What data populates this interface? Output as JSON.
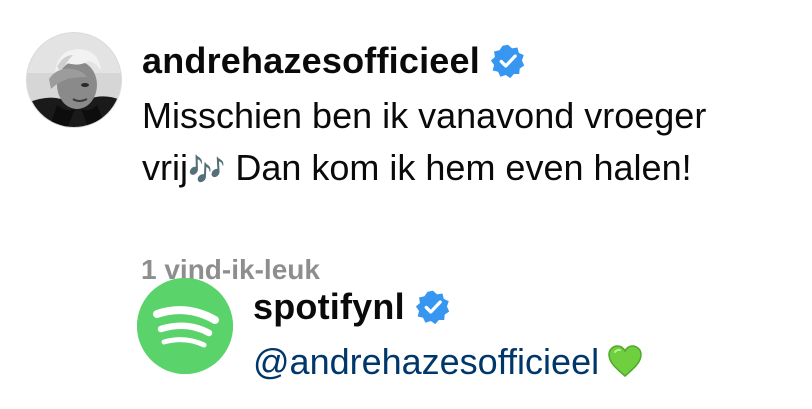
{
  "comment": {
    "username": "andrehazesofficieel",
    "verified": true,
    "text_line1": "Misschien ben ik vanavond vroeger",
    "text_line2_start": "vrij",
    "text_line2_notes": "🎶",
    "text_line2_end": " Dan kom ik hem even halen!",
    "likes": "1 vind-ik-leuk"
  },
  "reply": {
    "username": "spotifynl",
    "verified": true,
    "mention": "@andrehazesofficieel",
    "emoji": "green-heart"
  },
  "colors": {
    "verified": "#3797f0",
    "mention": "#00376b",
    "likes": "#8e8e8e",
    "spotify": "#5bd36b",
    "heart": "#6fcf3f"
  },
  "icons": {
    "verified": "verified-badge-icon",
    "spotify": "spotify-logo-icon",
    "heart": "green-heart-icon"
  }
}
